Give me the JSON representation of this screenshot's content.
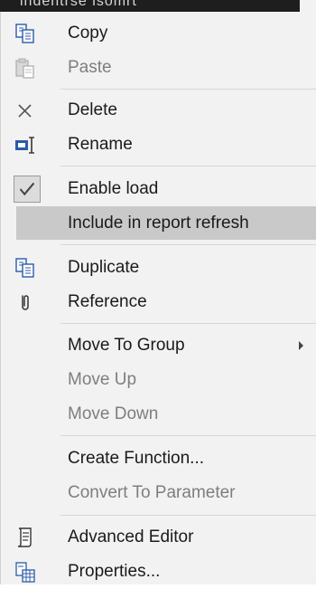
{
  "background": {
    "header_text": "indentrse isomrt"
  },
  "menu": {
    "items": [
      {
        "label": "Copy",
        "icon": "copy-icon",
        "enabled": true
      },
      {
        "label": "Paste",
        "icon": "paste-icon",
        "enabled": false
      },
      {
        "label": "Delete",
        "icon": "delete-icon",
        "enabled": true
      },
      {
        "label": "Rename",
        "icon": "rename-icon",
        "enabled": true
      },
      {
        "label": "Enable load",
        "icon": "checkmark-icon",
        "enabled": true,
        "checked": true
      },
      {
        "label": "Include in report refresh",
        "enabled": true,
        "hovered": true
      },
      {
        "label": "Duplicate",
        "icon": "duplicate-icon",
        "enabled": true
      },
      {
        "label": "Reference",
        "icon": "paperclip-icon",
        "enabled": true
      },
      {
        "label": "Move To Group",
        "enabled": true,
        "submenu": true
      },
      {
        "label": "Move Up",
        "enabled": false
      },
      {
        "label": "Move Down",
        "enabled": false
      },
      {
        "label": "Create Function...",
        "enabled": true
      },
      {
        "label": "Convert To Parameter",
        "enabled": false
      },
      {
        "label": "Advanced Editor",
        "icon": "advanced-editor-icon",
        "enabled": true
      },
      {
        "label": "Properties...",
        "icon": "properties-icon",
        "enabled": true
      }
    ]
  },
  "colors": {
    "menu_bg": "#f2f2f2",
    "hover_bg": "#c9c9c9",
    "text": "#1a1a1a",
    "disabled_text": "#7e7e7e",
    "separator": "#d6d6d6",
    "icon_blue": "#2b5aa8"
  }
}
